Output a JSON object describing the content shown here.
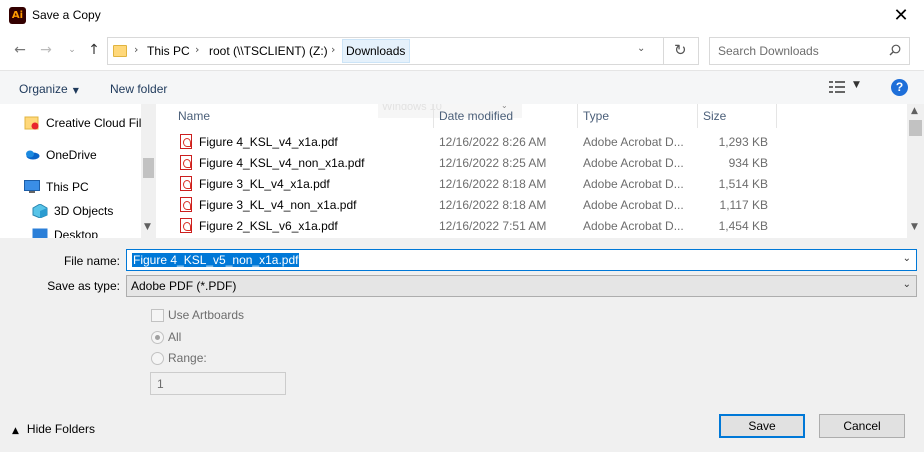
{
  "window": {
    "title": "Save a Copy",
    "app_icon_text": "Ai",
    "close_glyph": "✕"
  },
  "nav": {
    "back_icon": "back-arrow-icon",
    "forward_icon": "forward-arrow-icon",
    "up_icon": "up-arrow-icon",
    "breadcrumbs": [
      "This PC",
      "root (\\\\TSCLIENT) (Z:)",
      "Downloads"
    ],
    "refresh_icon": "refresh-icon",
    "search_placeholder": "Search Downloads"
  },
  "toolbar": {
    "organize_label": "Organize",
    "new_folder_label": "New folder",
    "help_label": "?"
  },
  "sidebar": {
    "items": [
      {
        "label": "Creative Cloud Fil",
        "icon": "creative-cloud-icon"
      },
      {
        "label": "OneDrive",
        "icon": "onedrive-icon"
      },
      {
        "label": "This PC",
        "icon": "this-pc-icon"
      },
      {
        "label": "3D Objects",
        "icon": "3d-objects-icon"
      },
      {
        "label": "Desktop",
        "icon": "desktop-icon"
      }
    ]
  },
  "files": {
    "columns": [
      "Name",
      "Date modified",
      "Type",
      "Size"
    ],
    "ghost_label": "Windows 10",
    "rows": [
      {
        "name": "Figure 4_KSL_v4_x1a.pdf",
        "date": "12/16/2022 8:26 AM",
        "type": "Adobe Acrobat D...",
        "size": "1,293 KB"
      },
      {
        "name": "Figure 4_KSL_v4_non_x1a.pdf",
        "date": "12/16/2022 8:25 AM",
        "type": "Adobe Acrobat D...",
        "size": "934 KB"
      },
      {
        "name": "Figure 3_KL_v4_x1a.pdf",
        "date": "12/16/2022 8:18 AM",
        "type": "Adobe Acrobat D...",
        "size": "1,514 KB"
      },
      {
        "name": "Figure 3_KL_v4_non_x1a.pdf",
        "date": "12/16/2022 8:18 AM",
        "type": "Adobe Acrobat D...",
        "size": "1,117 KB"
      },
      {
        "name": "Figure 2_KSL_v6_x1a.pdf",
        "date": "12/16/2022 7:51 AM",
        "type": "Adobe Acrobat D...",
        "size": "1,454 KB"
      }
    ]
  },
  "form": {
    "file_name_label": "File name:",
    "file_name_value": "Figure 4_KSL_v5_non_x1a.pdf",
    "save_type_label": "Save as type:",
    "save_type_value": "Adobe PDF (*.PDF)",
    "use_artboards_label": "Use Artboards",
    "all_label": "All",
    "range_label": "Range:",
    "range_value": "1"
  },
  "footer": {
    "hide_folders_label": "Hide Folders",
    "save_label": "Save",
    "cancel_label": "Cancel"
  },
  "colors": {
    "accent": "#0078d7",
    "toolbar_text": "#1e395b",
    "help": "#1e6fd9"
  }
}
